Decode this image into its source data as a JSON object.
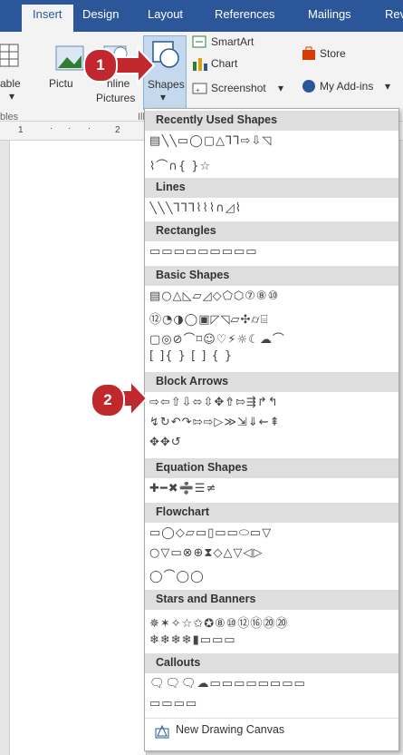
{
  "tabs": [
    "Insert",
    "Design",
    "Layout",
    "References",
    "Mailings",
    "Rev"
  ],
  "ribbon": {
    "table_label": "able",
    "pictures_label": "Pictu",
    "online_label_1": "nline",
    "online_label_2": "Pictures",
    "shapes_label": "Shapes",
    "smartart_label": "SmartArt",
    "chart_label": "Chart",
    "screenshot_label": "Screenshot",
    "store_label": "Store",
    "addins_label": "My Add-ins",
    "tables_group": "bles",
    "illustrations_group": "Ill"
  },
  "ruler": [
    "1",
    "2"
  ],
  "badges": [
    "1",
    "2"
  ],
  "dropdown": {
    "sections": [
      {
        "title": "Recently Used Shapes",
        "rows": [
          "▤╲╲▭◯▢△⅂⅂⇨⇩◹",
          "⌇⌒∩{ }☆"
        ]
      },
      {
        "title": "Lines",
        "rows": [
          "╲╲╲⅂⅂⅂⌇⌇⌇∩◿⌇"
        ]
      },
      {
        "title": "Rectangles",
        "rows": [
          "▭▭▭▭▭▭▭▭▭"
        ]
      },
      {
        "title": "Basic Shapes",
        "rows": [
          "▤○△◺▱◿◇⬠⬡⑦⑧⑩",
          "⑫◔◑◯▣◸◹▱✣⌭⌸",
          "▢◎⊘⌒⌑☺♡⚡☼☾☁⌒",
          "[ ]{ } [ ] { }"
        ]
      },
      {
        "title": "Block Arrows",
        "rows": [
          "⇨⇦⇧⇩⬄⇳✥⇮⇰⇶↱↰",
          "↯↻↶↷⇰⇨▷≫⇲⇓⇜⇞",
          "✥✥↺"
        ]
      },
      {
        "title": "Equation Shapes",
        "rows": [
          "✚━✖➗☰≠"
        ]
      },
      {
        "title": "Flowchart",
        "rows": [
          "▭◯◇▱▭▯▭▭⬭▭▽",
          "○▽▭⊗⊕⧗◇△▽◁▷",
          "◯⌒◯◯"
        ]
      },
      {
        "title": "Stars and Banners",
        "rows": [
          "✵✶✧☆✩✪⑧⑩⑫⑯⑳⑳",
          "❄❄❄❄▮▭▭▭"
        ]
      },
      {
        "title": "Callouts",
        "rows": [
          "🗨🗨🗨☁▭▭▭▭▭▭▭▭",
          "▭▭▭▭"
        ]
      }
    ],
    "canvas_label": "New Drawing Canvas"
  }
}
